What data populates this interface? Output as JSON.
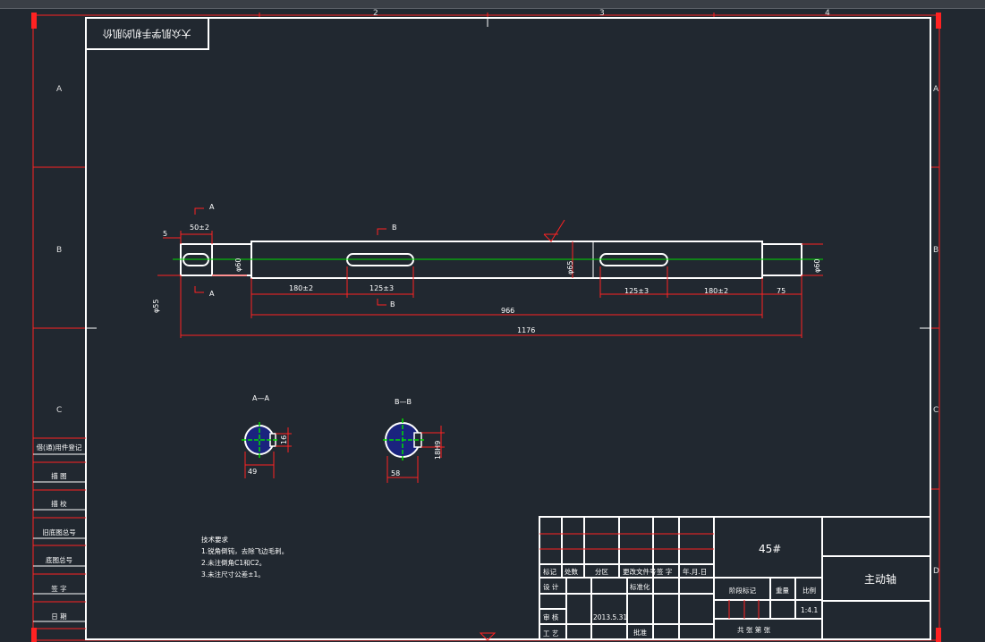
{
  "window": {
    "accent_color": "#ff2222",
    "background": "#212830"
  },
  "stamp": {
    "text": "大众肌学手机的肌价"
  },
  "frame": {
    "row_letters": [
      "A",
      "B",
      "C"
    ],
    "right_letters": [
      "A",
      "B",
      "C",
      "D"
    ],
    "col_numbers": [
      "2",
      "3",
      "4"
    ]
  },
  "side_table": {
    "rows": [
      "借(通)用件登记",
      "描 图",
      "描 校",
      "旧底图总号",
      "底图总号",
      "签 字",
      "日 期"
    ]
  },
  "drawing": {
    "dims": {
      "d5": "5",
      "d50": "50±2",
      "d180a": "180±2",
      "d125a": "125±3",
      "d966": "966",
      "d1176": "1176",
      "d125b": "125±3",
      "d180b": "180±2",
      "d75": "75",
      "phi55": "φ55",
      "phi60a": "φ60",
      "phi65": "φ65",
      "phi60b": "φ60"
    },
    "section_markers": {
      "a": "A",
      "b": "B"
    },
    "sections": {
      "aa_title": "A—A",
      "aa_width": "49",
      "aa_key": "16",
      "bb_title": "B—B",
      "bb_width": "58",
      "bb_key": "18H9"
    },
    "notes": {
      "title": "技术要求",
      "lines": [
        "1.锐角倒钝，去除飞边毛刺。",
        "2.未注倒角C1和C2。",
        "3.未注尺寸公差±1。"
      ]
    }
  },
  "title_block": {
    "material": "45#",
    "part_name": "主动轴",
    "h_marker": "标记",
    "h_count": "处数",
    "h_zone": "分区",
    "h_change_doc": "更改文件号",
    "h_sign": "签 字",
    "h_date": "年.月.日",
    "design": "设 计",
    "standardize": "标准化",
    "stage_mark": "阶段标记",
    "weight": "重量",
    "scale_label": "比例",
    "scale_value": "1:4.1",
    "review": "审 核",
    "process": "工 艺",
    "approve": "批准",
    "date": "2013.5.31",
    "sheets": "共 张 第 张"
  }
}
